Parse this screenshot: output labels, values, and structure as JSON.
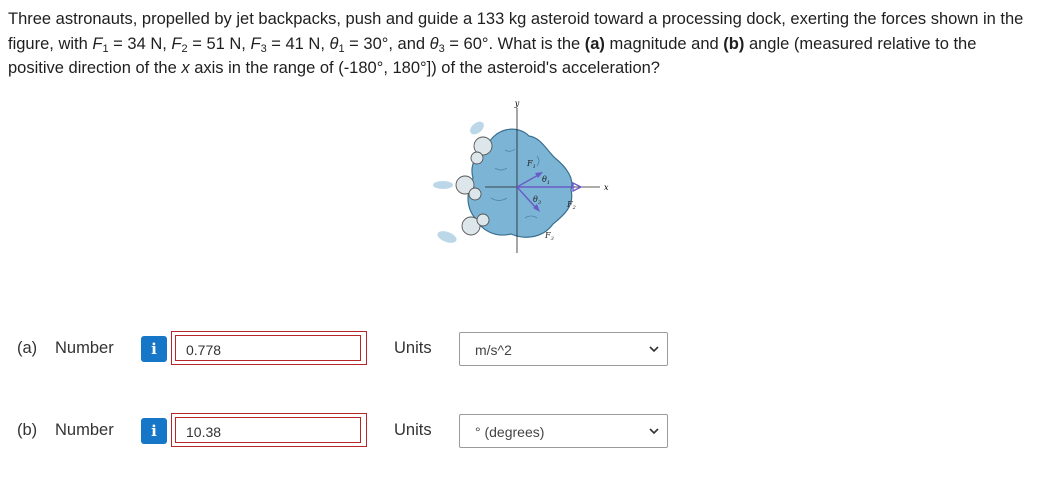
{
  "question": {
    "intro": "Three astronauts, propelled by jet backpacks, push and guide a 133 kg asteroid toward a processing dock, exerting the forces shown in the figure, with ",
    "f1_sym": "F",
    "f1_sub": "1",
    "f1_val": " = 34 N, ",
    "f2_sym": "F",
    "f2_sub": "2",
    "f2_val": " = 51 N, ",
    "f3_sym": "F",
    "f3_sub": "3",
    "f3_val": " = 41 N, ",
    "t1_sym": "θ",
    "t1_sub": "1",
    "t1_val": " = 30°, and ",
    "t3_sym": "θ",
    "t3_sub": "3",
    "t3_val": " = 60°. What is the ",
    "part_a_tag": "(a)",
    "mid1": " magnitude and ",
    "part_b_tag": "(b)",
    "mid2": " angle (measured relative to the positive direction of the ",
    "x_var": "x",
    "end": " axis in the range of (-180°, 180°]) of the asteroid's acceleration?"
  },
  "figure": {
    "axis_y": "y",
    "axis_x": "x",
    "f1_label": "F",
    "f1_sub": "1",
    "f2_label": "F",
    "f2_sub": "2",
    "f3_label": "F",
    "f3_sub": "3",
    "theta1_label": "θ",
    "theta1_sub": "1",
    "theta3_label": "θ",
    "theta3_sub": "3",
    "colors": {
      "asteroid": "#7bb4d4",
      "force_arrow": "#6a5cc8",
      "axis": "#222222"
    }
  },
  "answers": [
    {
      "part": "(a)",
      "number_label": "Number",
      "info_icon": "i",
      "value": "0.778",
      "units_label": "Units",
      "unit_selected": "m/s^2"
    },
    {
      "part": "(b)",
      "number_label": "Number",
      "info_icon": "i",
      "value": "10.38",
      "units_label": "Units",
      "unit_selected": "° (degrees)"
    }
  ],
  "colors": {
    "info_button": "#1677c8",
    "answer_border": "#b9262a",
    "select_border": "#9b9b9b"
  }
}
